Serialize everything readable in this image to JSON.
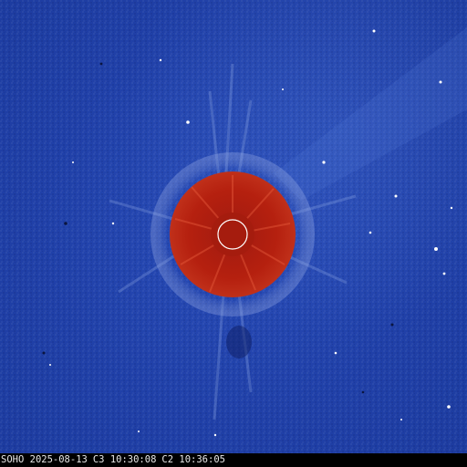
{
  "caption": {
    "observatory": "SOHO",
    "date": "2025-08-13",
    "c3_label": "C3",
    "c3_time": "10:30:08",
    "c2_label": "C2",
    "c2_time": "10:36:05"
  },
  "colors": {
    "sky": "#2245ad",
    "occulter": "#b5200f",
    "sun_outline": "#ffffff",
    "caption_bar": "#000000"
  }
}
